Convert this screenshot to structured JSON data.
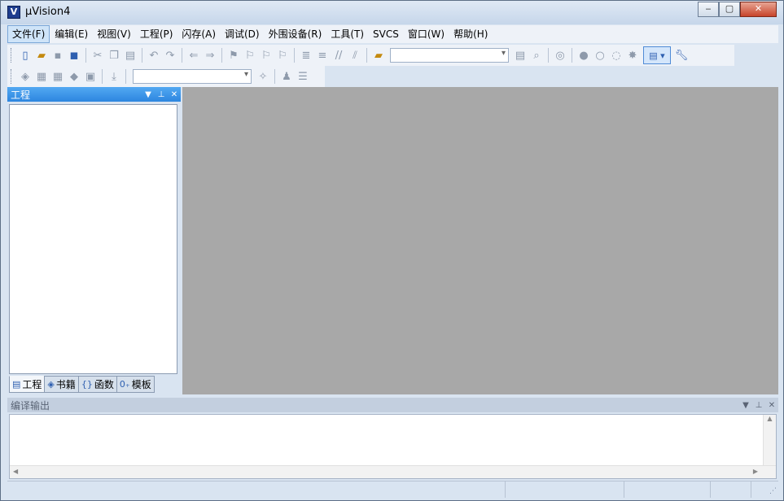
{
  "window": {
    "title": "μVision4"
  },
  "menu": [
    "文件(F)",
    "编辑(E)",
    "视图(V)",
    "工程(P)",
    "闪存(A)",
    "调试(D)",
    "外围设备(R)",
    "工具(T)",
    "SVCS",
    "窗口(W)",
    "帮助(H)"
  ],
  "project_panel": {
    "title": "工程",
    "tabs": [
      "工程",
      "书籍",
      "函数",
      "模板"
    ]
  },
  "build_panel": {
    "title": "编译输出"
  },
  "icons": {
    "toolbar1": [
      "new-file-icon",
      "open-file-icon",
      "save-icon",
      "save-all-icon",
      "cut-icon",
      "copy-icon",
      "paste-icon",
      "undo-icon",
      "redo-icon",
      "nav-back-icon",
      "nav-forward-icon",
      "bookmark-icon",
      "bookmark-prev-icon",
      "bookmark-next-icon",
      "bookmark-clear-icon",
      "indent-icon",
      "unindent-icon",
      "comment-icon",
      "uncomment-icon",
      "find-in-files-icon",
      "find-icon",
      "incremental-find-icon",
      "debug-icon",
      "breakpoint-icon",
      "breakpoint-disable-icon",
      "breakpoint-disable-all-icon",
      "breakpoint-kill-all-icon",
      "window-layout-icon",
      "configure-icon"
    ],
    "toolbar2": [
      "translate-icon",
      "build-icon",
      "rebuild-icon",
      "batch-build-icon",
      "stop-build-icon",
      "download-icon",
      "target-options-icon",
      "manage-components-icon",
      "manage-books-icon"
    ]
  },
  "accent": "#2d86e0"
}
